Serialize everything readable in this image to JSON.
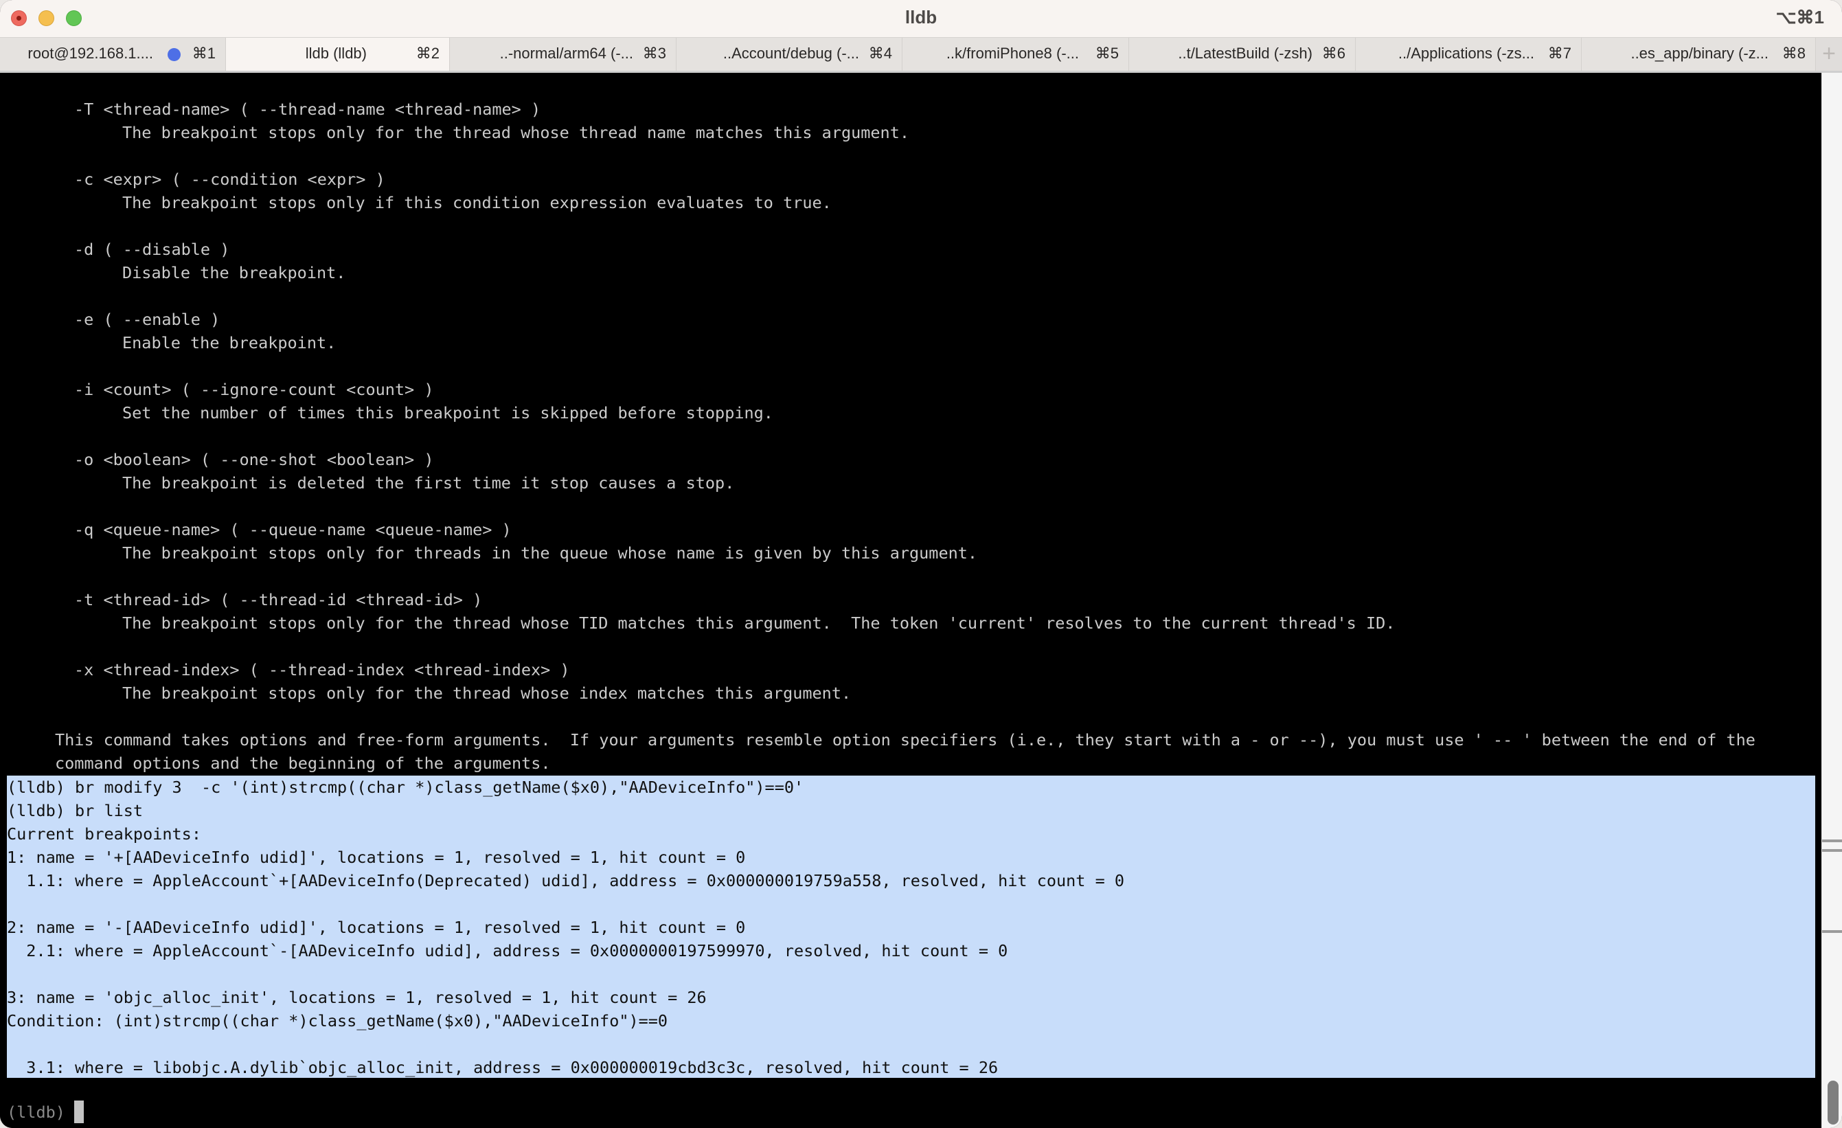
{
  "window": {
    "title": "lldb",
    "shortcut": "⌥⌘1"
  },
  "tabs": [
    {
      "label": "root@192.168.1....",
      "key": "⌘1",
      "has_activity_dot": true,
      "active": false
    },
    {
      "label": "lldb (lldb)",
      "key": "⌘2",
      "active": true
    },
    {
      "label": "..-normal/arm64 (-...",
      "key": "⌘3",
      "active": false
    },
    {
      "label": "..Account/debug (-...",
      "key": "⌘4",
      "active": false
    },
    {
      "label": "..k/fromiPhone8 (-...",
      "key": "⌘5",
      "active": false
    },
    {
      "label": "..t/LatestBuild (-zsh)",
      "key": "⌘6",
      "active": false
    },
    {
      "label": "../Applications (-zs...",
      "key": "⌘7",
      "active": false
    },
    {
      "label": "..es_app/binary (-z...",
      "key": "⌘8",
      "active": false
    }
  ],
  "new_tab_label": "+",
  "help_options": [
    {
      "flag": "-T <thread-name> ( --thread-name <thread-name> )",
      "desc": "The breakpoint stops only for the thread whose thread name matches this argument."
    },
    {
      "flag": "-c <expr> ( --condition <expr> )",
      "desc": "The breakpoint stops only if this condition expression evaluates to true."
    },
    {
      "flag": "-d ( --disable )",
      "desc": "Disable the breakpoint."
    },
    {
      "flag": "-e ( --enable )",
      "desc": "Enable the breakpoint."
    },
    {
      "flag": "-i <count> ( --ignore-count <count> )",
      "desc": "Set the number of times this breakpoint is skipped before stopping."
    },
    {
      "flag": "-o <boolean> ( --one-shot <boolean> )",
      "desc": "The breakpoint is deleted the first time it stop causes a stop."
    },
    {
      "flag": "-q <queue-name> ( --queue-name <queue-name> )",
      "desc": "The breakpoint stops only for threads in the queue whose name is given by this argument."
    },
    {
      "flag": "-t <thread-id> ( --thread-id <thread-id> )",
      "desc": "The breakpoint stops only for the thread whose TID matches this argument.  The token 'current' resolves to the current thread's ID."
    },
    {
      "flag": "-x <thread-index> ( --thread-index <thread-index> )",
      "desc": "The breakpoint stops only for the thread whose index matches this argument."
    }
  ],
  "help_footer": [
    "This command takes options and free-form arguments.  If your arguments resemble option specifiers (i.e., they start with a - or --), you must use ' -- ' between the end of the",
    "command options and the beginning of the arguments."
  ],
  "selected_output": [
    "(lldb) br modify 3  -c '(int)strcmp((char *)class_getName($x0),\"AADeviceInfo\")==0'",
    "(lldb) br list",
    "Current breakpoints:",
    "1: name = '+[AADeviceInfo udid]', locations = 1, resolved = 1, hit count = 0",
    "  1.1: where = AppleAccount`+[AADeviceInfo(Deprecated) udid], address = 0x000000019759a558, resolved, hit count = 0",
    "",
    "2: name = '-[AADeviceInfo udid]', locations = 1, resolved = 1, hit count = 0",
    "  2.1: where = AppleAccount`-[AADeviceInfo udid], address = 0x0000000197599970, resolved, hit count = 0",
    "",
    "3: name = 'objc_alloc_init', locations = 1, resolved = 1, hit count = 26",
    "Condition: (int)strcmp((char *)class_getName($x0),\"AADeviceInfo\")==0",
    "",
    "  3.1: where = libobjc.A.dylib`objc_alloc_init, address = 0x000000019cbd3c3c, resolved, hit count = 26"
  ],
  "prompt": "(lldb)",
  "colors": {
    "terminal_bg": "#000000",
    "terminal_fg": "#cbcbcb",
    "selection_bg": "#c8ddfa",
    "activity_dot": "#4e6fe6"
  }
}
